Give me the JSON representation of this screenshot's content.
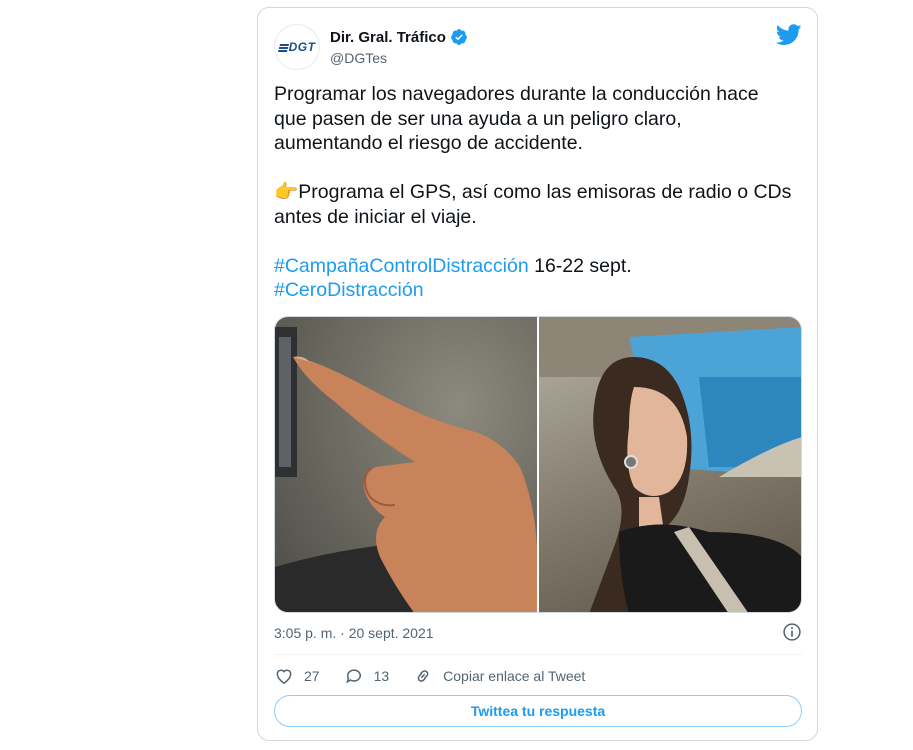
{
  "author": {
    "name": "Dir. Gral. Tráfico",
    "handle": "@DGTes",
    "avatar_text": "DGT"
  },
  "tweet": {
    "line1": "Programar los navegadores durante la conducción hace",
    "line2": "que pasen de ser una ayuda a un peligro claro,",
    "line3": "aumentando el riesgo de accidente.",
    "emoji": "👉",
    "line4": "Programa el GPS, así como las emisoras de radio o CDs",
    "line5": "antes de iniciar el viaje.",
    "hashtag1": "#CampañaControlDistracción",
    "hashtag1_suffix": " 16-22 sept.",
    "hashtag2": "#CeroDistracción"
  },
  "meta": {
    "timestamp": "3:05 p. m. · 20 sept. 2021"
  },
  "actions": {
    "likes": "27",
    "replies": "13",
    "copy_link": "Copiar enlace al Tweet"
  },
  "reply_button": "Twittea tu respuesta",
  "colors": {
    "accent": "#1d9bf0",
    "text": "#0f1419",
    "secondary": "#536471",
    "border": "#cfd9de"
  },
  "icons": [
    "verified-badge-icon",
    "twitter-bird-icon",
    "info-icon",
    "heart-icon",
    "reply-bubble-icon",
    "link-icon"
  ]
}
